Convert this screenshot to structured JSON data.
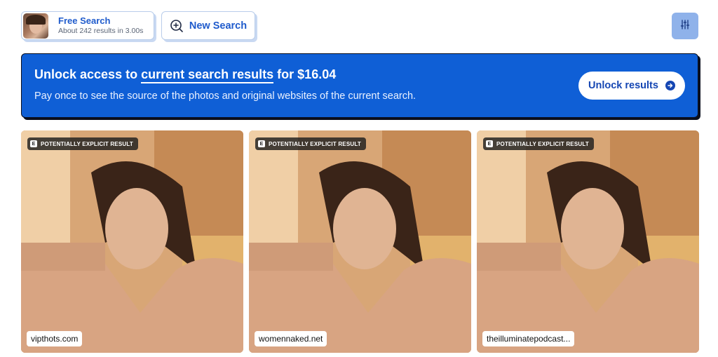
{
  "topbar": {
    "free_search": {
      "title": "Free Search",
      "subtitle": "About 242 results in 3.00s"
    },
    "new_search_label": "New Search",
    "filter_icon": "sliders-icon"
  },
  "banner": {
    "title_prefix": "Unlock access to ",
    "title_link": "current search results",
    "title_suffix": " for $16.04",
    "subtitle": "Pay once to see the source of the photos and original websites of the current search.",
    "button_label": "Unlock results",
    "button_icon": "arrow-right-circle-icon"
  },
  "results": [
    {
      "badge_letter": "E",
      "badge": "POTENTIALLY EXPLICIT RESULT",
      "site": "vipthots.com"
    },
    {
      "badge_letter": "E",
      "badge": "POTENTIALLY EXPLICIT RESULT",
      "site": "womennaked.net"
    },
    {
      "badge_letter": "E",
      "badge": "POTENTIALLY EXPLICIT RESULT",
      "site": "theilluminatepodcast..."
    }
  ],
  "colors": {
    "accent": "#1f5bcc",
    "banner": "#0f5fd6",
    "filter_button": "#8fb2ea"
  }
}
